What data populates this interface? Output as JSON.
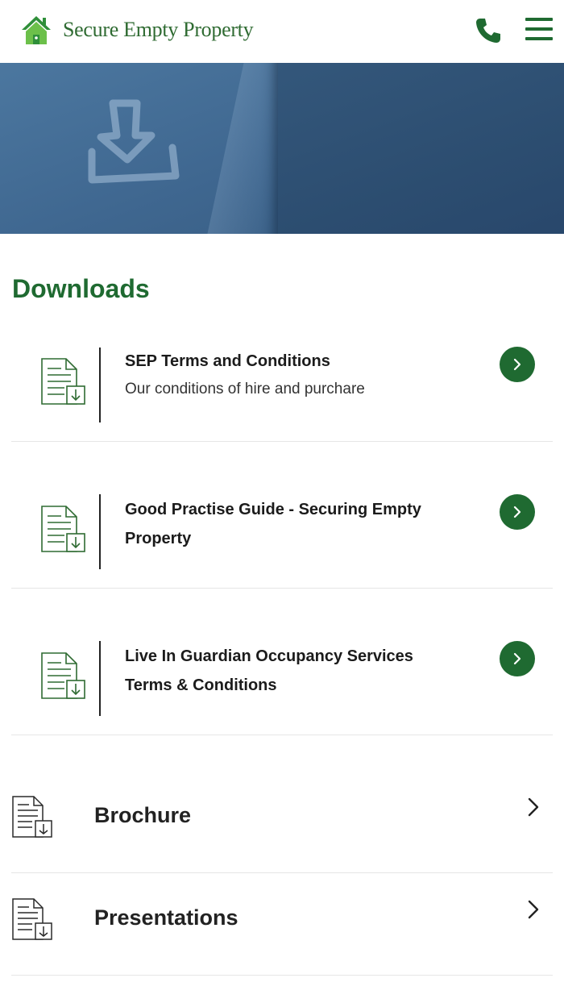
{
  "header": {
    "brand": "Secure Empty Property",
    "logo_icon": "house-icon",
    "phone_icon": "phone-icon",
    "menu_icon": "hamburger-menu-icon",
    "colors": {
      "brand_green": "#1f6a31",
      "logo_green": "#6cc04a"
    }
  },
  "hero": {
    "icon": "download-icon"
  },
  "page": {
    "title": "Downloads"
  },
  "downloads": [
    {
      "title": "SEP Terms and Conditions",
      "subtitle": "Our conditions of hire and purchare"
    },
    {
      "title": "Good Practise Guide - Securing Empty Property",
      "subtitle": ""
    },
    {
      "title": "Live In Guardian Occupancy Services Terms & Conditions",
      "subtitle": ""
    }
  ],
  "sections": [
    {
      "label": "Brochure"
    },
    {
      "label": "Presentations"
    }
  ]
}
